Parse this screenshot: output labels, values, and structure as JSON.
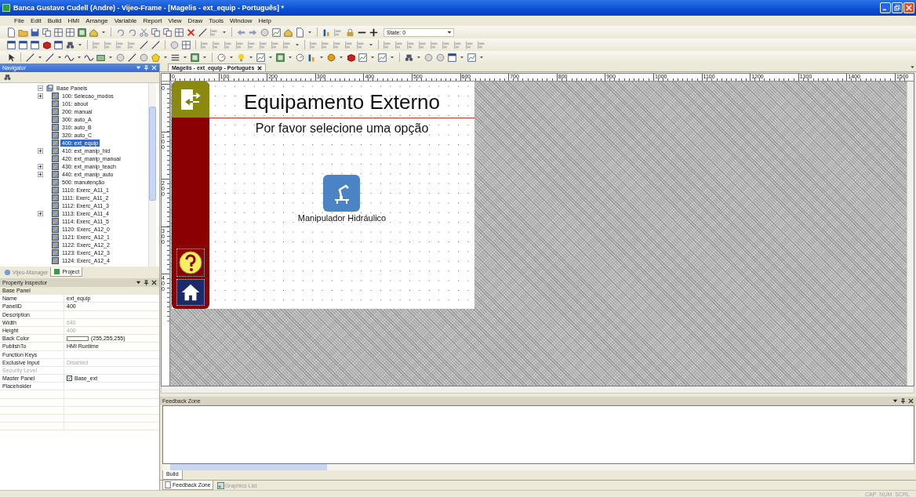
{
  "window": {
    "title": "Banca Gustavo Cudell (Andre) - Vijeo-Frame - [Magelis - ext_equip - Português] *"
  },
  "menu": [
    "File",
    "Edit",
    "Build",
    "HMI",
    "Arrange",
    "Variable",
    "Report",
    "View",
    "Draw",
    "Tools",
    "Window",
    "Help"
  ],
  "toolbar": {
    "state_label": "State: 0"
  },
  "navigator": {
    "title": "Navigator",
    "tree": {
      "label": "Base Panels",
      "expanded": true,
      "children": [
        {
          "label": "100: Selecao_modos",
          "has_children": true,
          "selected": false
        },
        {
          "label": "101: about",
          "has_children": false,
          "selected": false
        },
        {
          "label": "200: manual",
          "has_children": false,
          "selected": false
        },
        {
          "label": "300: auto_A",
          "has_children": false,
          "selected": false
        },
        {
          "label": "310: auto_B",
          "has_children": false,
          "selected": false
        },
        {
          "label": "320: auto_C",
          "has_children": false,
          "selected": false
        },
        {
          "label": "400: ext_equip",
          "has_children": false,
          "selected": true
        },
        {
          "label": "410: ext_manip_hid",
          "has_children": true,
          "selected": false
        },
        {
          "label": "420: ext_manip_manual",
          "has_children": false,
          "selected": false
        },
        {
          "label": "430: ext_manip_teach",
          "has_children": true,
          "selected": false
        },
        {
          "label": "440: ext_manip_auto",
          "has_children": true,
          "selected": false
        },
        {
          "label": "500: manutenção",
          "has_children": false,
          "selected": false
        },
        {
          "label": "1110: Exerc_A11_1",
          "has_children": false,
          "selected": false
        },
        {
          "label": "1111: Exerc_A11_2",
          "has_children": false,
          "selected": false
        },
        {
          "label": "1112: Exerc_A11_3",
          "has_children": false,
          "selected": false
        },
        {
          "label": "1113: Exerc_A11_4",
          "has_children": true,
          "selected": false
        },
        {
          "label": "1114: Exerc_A11_5",
          "has_children": false,
          "selected": false
        },
        {
          "label": "1120: Exerc_A12_0",
          "has_children": false,
          "selected": false
        },
        {
          "label": "1121: Exerc_A12_1",
          "has_children": false,
          "selected": false
        },
        {
          "label": "1122: Exerc_A12_2",
          "has_children": false,
          "selected": false
        },
        {
          "label": "1123: Exerc_A12_3",
          "has_children": false,
          "selected": false
        },
        {
          "label": "1124: Exerc_A12_4",
          "has_children": false,
          "selected": false
        }
      ]
    },
    "tabs": [
      {
        "label": "Vijeo-Manager",
        "selected": false
      },
      {
        "label": "Project",
        "selected": true
      }
    ]
  },
  "property_inspector": {
    "title": "Property Inspector",
    "section": "Base Panel",
    "rows": [
      {
        "name": "Name",
        "value": "ext_equip",
        "kind": "text",
        "disabled": false
      },
      {
        "name": "PanelID",
        "value": "400",
        "kind": "text",
        "disabled": false
      },
      {
        "name": "Description",
        "kind": "text",
        "disabled": false
      },
      {
        "name": "Width",
        "value": "640",
        "kind": "text",
        "disabled": true
      },
      {
        "name": "Height",
        "value": "400",
        "kind": "text",
        "disabled": true
      },
      {
        "name": "Back Color",
        "value": "(255,255,255)",
        "kind": "color",
        "color": "#ffffff",
        "disabled": false
      },
      {
        "name": "PublishTo",
        "value": "HMI Runtime",
        "kind": "text",
        "disabled": false
      },
      {
        "name": "Function Keys",
        "kind": "text",
        "disabled": false
      },
      {
        "name": "Exclusive Input",
        "value": "Disabled",
        "kind": "text",
        "disabled": true
      },
      {
        "name": "Security Level",
        "kind": "text",
        "disabled": true
      },
      {
        "name": "Master Panel",
        "value": "Base_ext",
        "kind": "checkbox",
        "checked": true,
        "disabled": false
      },
      {
        "name": "Placeholder",
        "kind": "text",
        "disabled": false
      }
    ]
  },
  "document_tabs": [
    {
      "label": "Magelis - ext_equip - Português",
      "selected": true
    }
  ],
  "rulers": {
    "horizontal": [
      "0",
      "100",
      "200",
      "300",
      "400",
      "500",
      "600",
      "700",
      "800",
      "900",
      "1000",
      "1100",
      "1200",
      "1300",
      "1400",
      "1500"
    ],
    "vertical": [
      "0",
      "100",
      "200",
      "300",
      "400"
    ]
  },
  "panel": {
    "title": "Equipamento Externo",
    "subtitle": "Por favor selecione uma opção",
    "buttons": [
      {
        "label": "Manipulador Hidráulico"
      }
    ]
  },
  "feedback_zone": {
    "title": "Feedback Zone",
    "tabs": [
      {
        "label": "Build",
        "selected": true
      }
    ]
  },
  "bottom_tabs": [
    {
      "label": "Feedback Zone",
      "selected": true
    },
    {
      "label": "Graphics List",
      "selected": false
    }
  ],
  "status_bar": [
    "CAP",
    "NUM",
    "SCRL"
  ]
}
